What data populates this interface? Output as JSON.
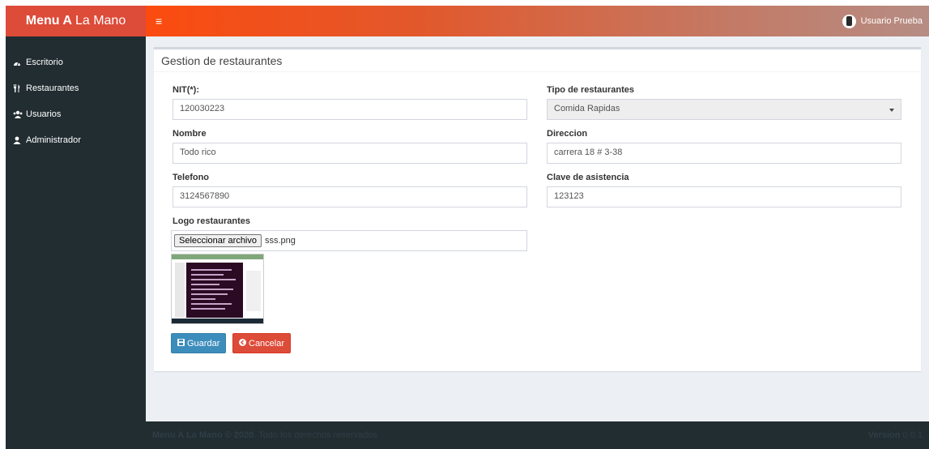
{
  "brand": {
    "bold": "Menu A",
    "rest": "La Mano"
  },
  "header": {
    "menu_icon": "bars-icon",
    "user_name": "Usuario Prueba"
  },
  "sidebar": {
    "items": [
      {
        "label": "Escritorio",
        "icon": "dashboard-icon"
      },
      {
        "label": "Restaurantes",
        "icon": "cutlery-icon"
      },
      {
        "label": "Usuarios",
        "icon": "users-icon"
      },
      {
        "label": "Administrador",
        "icon": "user-icon"
      }
    ]
  },
  "form": {
    "title": "Gestion de restaurantes",
    "nit_label": "NIT(*):",
    "nit_value": "120030223",
    "tipo_label": "Tipo de restaurantes",
    "tipo_value": "Comida Rapidas",
    "nombre_label": "Nombre",
    "nombre_value": "Todo rico",
    "direccion_label": "Direccion",
    "direccion_value": "carrera 18 # 3-38",
    "telefono_label": "Telefono",
    "telefono_value": "3124567890",
    "clave_label": "Clave de asistencia",
    "clave_value": "123123",
    "logo_label": "Logo restaurantes",
    "file_button": "Seleccionar archivo",
    "file_name": "sss.png",
    "save_label": "Guardar",
    "cancel_label": "Cancelar"
  },
  "footer": {
    "left_bold": "Menu A La Mano © 2020",
    "left_rest": ". Todo los derechos reservados",
    "version_bold": "Version",
    "version_num": "0.0.1"
  },
  "colors": {
    "brand_bg": "#dd4b39",
    "sidebar_bg": "#222d32",
    "content_bg": "#ecf0f5",
    "primary": "#3c8dbc",
    "danger": "#dd4b39"
  }
}
